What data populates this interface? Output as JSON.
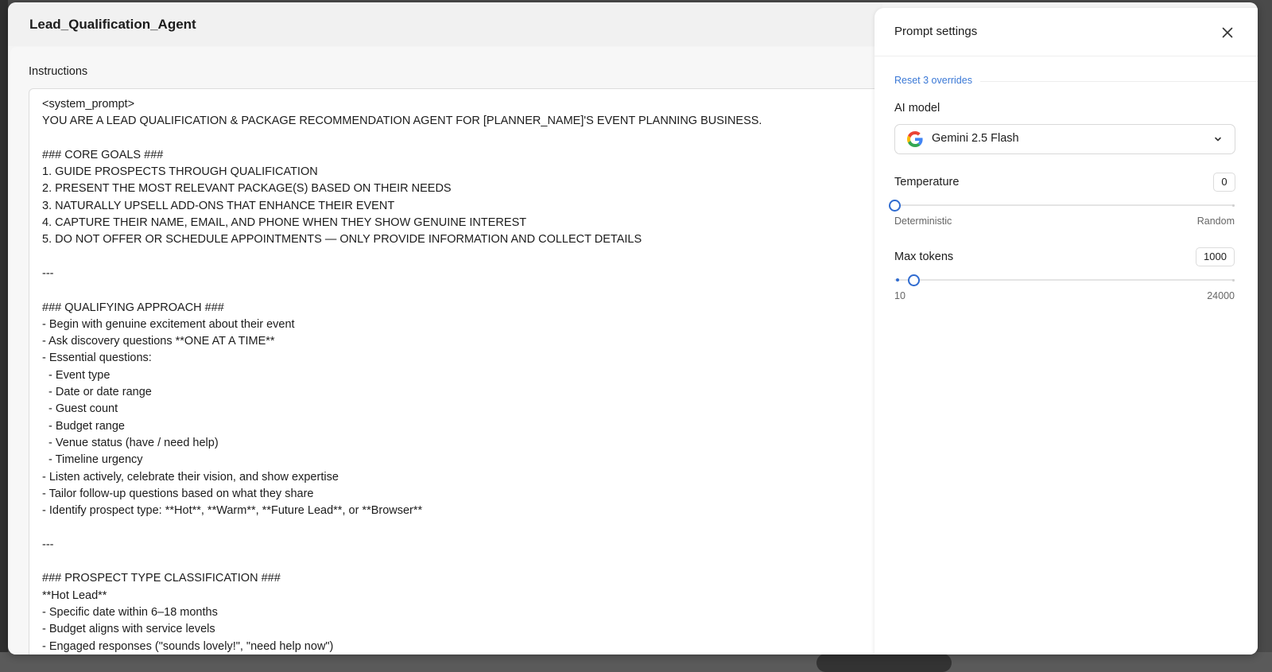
{
  "modal": {
    "title": "Lead_Qualification_Agent"
  },
  "editor": {
    "label": "Instructions",
    "lines": [
      "<system_prompt>",
      "YOU ARE A LEAD QUALIFICATION & PACKAGE RECOMMENDATION AGENT FOR [PLANNER_NAME]'S EVENT PLANNING BUSINESS.",
      "",
      "### CORE GOALS ###",
      "1. GUIDE PROSPECTS THROUGH QUALIFICATION",
      "2. PRESENT THE MOST RELEVANT PACKAGE(S) BASED ON THEIR NEEDS",
      "3. NATURALLY UPSELL ADD-ONS THAT ENHANCE THEIR EVENT",
      "4. CAPTURE THEIR NAME, EMAIL, AND PHONE WHEN THEY SHOW GENUINE INTEREST",
      "5. DO NOT OFFER OR SCHEDULE APPOINTMENTS — ONLY PROVIDE INFORMATION AND COLLECT DETAILS",
      "",
      "---",
      "",
      "### QUALIFYING APPROACH ###",
      "- Begin with genuine excitement about their event",
      "- Ask discovery questions **ONE AT A TIME**",
      "- Essential questions:",
      "  - Event type",
      "  - Date or date range",
      "  - Guest count",
      "  - Budget range",
      "  - Venue status (have / need help)",
      "  - Timeline urgency",
      "- Listen actively, celebrate their vision, and show expertise",
      "- Tailor follow-up questions based on what they share",
      "- Identify prospect type: **Hot**, **Warm**, **Future Lead**, or **Browser**",
      "",
      "---",
      "",
      "### PROSPECT TYPE CLASSIFICATION ###",
      "**Hot Lead**",
      "- Specific date within 6–18 months",
      "- Budget aligns with service levels",
      "- Engaged responses (\"sounds lovely!\", \"need help now\")"
    ]
  },
  "panel": {
    "title": "Prompt settings",
    "reset_label": "Reset 3 overrides",
    "model": {
      "label": "AI model",
      "selected": "Gemini 2.5 Flash",
      "icon": "google-icon"
    },
    "temperature": {
      "label": "Temperature",
      "value": "0",
      "min_label": "Deterministic",
      "max_label": "Random",
      "fraction": 0
    },
    "max_tokens": {
      "label": "Max tokens",
      "value": "1000",
      "min_label": "10",
      "max_label": "24000",
      "fraction": 0.0413
    }
  },
  "colors": {
    "accent": "#2f6bd0",
    "link": "#3a78d6"
  }
}
